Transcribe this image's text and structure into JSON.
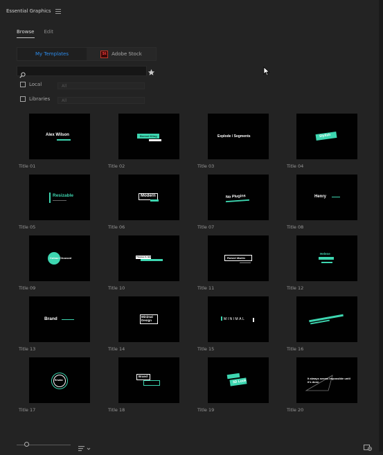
{
  "panel": {
    "title": "Essential Graphics"
  },
  "tabs": [
    {
      "label": "Browse"
    },
    {
      "label": "Edit"
    }
  ],
  "source": {
    "my_templates": "My Templates",
    "adobe_stock": "Adobe Stock",
    "stock_badge": "St"
  },
  "search": {
    "placeholder": ""
  },
  "filters": [
    {
      "label": "Local",
      "select": "All"
    },
    {
      "label": "Libraries",
      "select": "All"
    }
  ],
  "templates": [
    {
      "caption": "Title 01",
      "text": "Alex Wilson"
    },
    {
      "caption": "Title 02",
      "text": "Bennet Kling"
    },
    {
      "caption": "Title 03",
      "text": "Explode / Segments"
    },
    {
      "caption": "Title 04",
      "text": "Stylish"
    },
    {
      "caption": "Title 05",
      "text": "Resizable"
    },
    {
      "caption": "Title 06",
      "text": "Modern"
    },
    {
      "caption": "Title 07",
      "text": "No Plugins"
    },
    {
      "caption": "Title 08",
      "text": "Henry"
    },
    {
      "caption": "Title 09",
      "text": "Colour Choosed"
    },
    {
      "caption": "Title 10",
      "text": "Thomas S. Hill"
    },
    {
      "caption": "Title 11",
      "text": "Robert Martin"
    },
    {
      "caption": "Title 12",
      "text": "Helene"
    },
    {
      "caption": "Title 13",
      "text": "Brand"
    },
    {
      "caption": "Title 14",
      "text": "Minimal Design"
    },
    {
      "caption": "Title 15",
      "text": "MINIMAL"
    },
    {
      "caption": "Title 16",
      "text": ""
    },
    {
      "caption": "Title 17",
      "text": "Envato"
    },
    {
      "caption": "Title 18",
      "text": "Brand"
    },
    {
      "caption": "Title 19",
      "text": "3D Look"
    },
    {
      "caption": "Title 20",
      "text": "It always seems impossible until it's done."
    }
  ],
  "colors": {
    "accent": "#3dd6b0",
    "link": "#2d8ceb",
    "panel_bg": "#232323"
  }
}
